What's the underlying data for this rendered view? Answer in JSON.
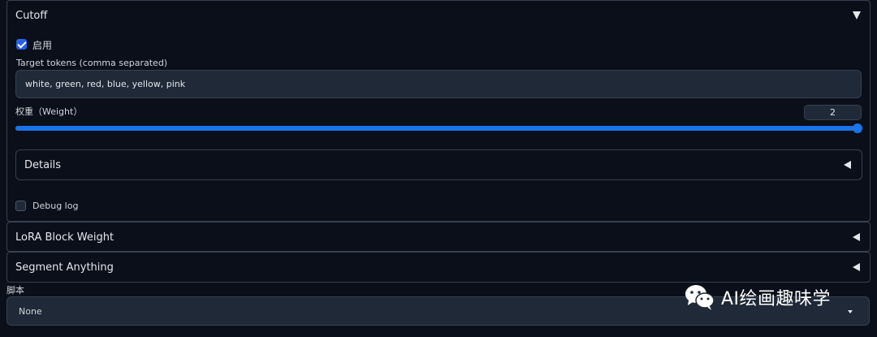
{
  "cutoff": {
    "title": "Cutoff",
    "enable_label": "启用",
    "enabled": true,
    "target_tokens_label": "Target tokens (comma separated)",
    "target_tokens_value": "white, green, red, blue, yellow, pink",
    "weight_label": "权重（Weight）",
    "weight_value": "2",
    "weight_fraction": 1.0,
    "details_title": "Details",
    "debug_log_label": "Debug log",
    "debug_log_checked": false
  },
  "accordions": {
    "lora_block_weight": "LoRA Block Weight",
    "segment_anything": "Segment Anything"
  },
  "script": {
    "label": "脚本",
    "selected": "None"
  },
  "watermark": {
    "text": "AI绘画趣味学",
    "icon": "wechat-icon"
  },
  "colors": {
    "accent": "#1a73e8",
    "background": "#0b0f19",
    "input_bg": "#1f2937"
  }
}
